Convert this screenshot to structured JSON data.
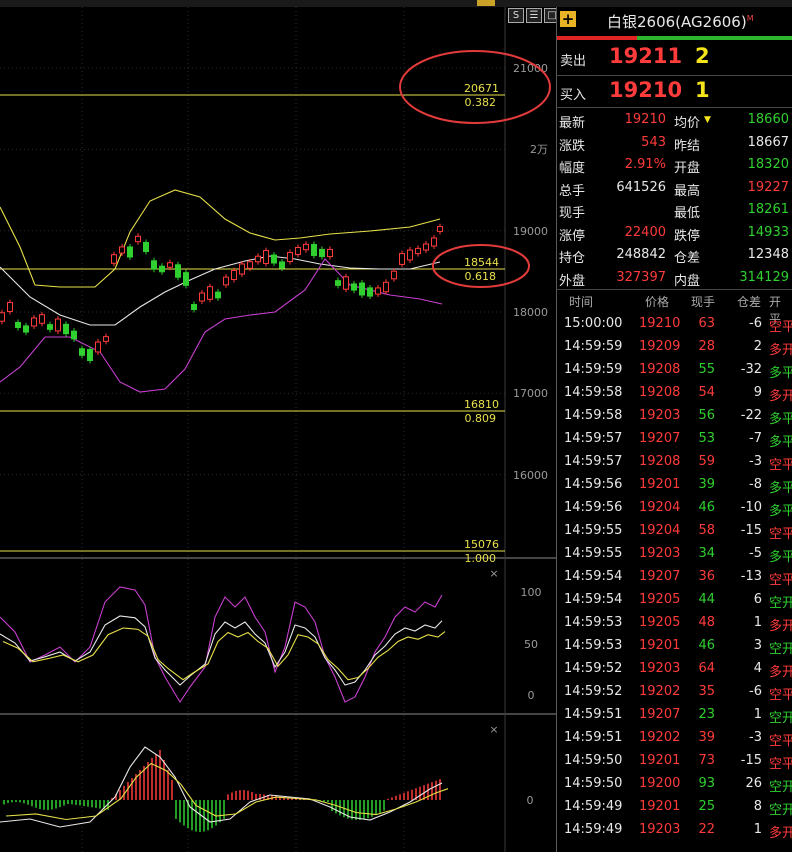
{
  "window_buttons": [
    "S",
    "☰",
    "□"
  ],
  "instrument": {
    "name": "白银2606(AG2606)",
    "marker": "M"
  },
  "quote": {
    "sell_label": "卖出",
    "sell_price": "19211",
    "sell_vol": "2",
    "buy_label": "买入",
    "buy_price": "19210",
    "buy_vol": "1"
  },
  "stats": [
    {
      "l1": "最新",
      "v1": "19210",
      "c1": "red",
      "l2": "均价",
      "v2": "18660",
      "c2": "green"
    },
    {
      "l1": "涨跌",
      "v1": "543",
      "c1": "red",
      "l2": "昨结",
      "v2": "18667",
      "c2": "white"
    },
    {
      "l1": "幅度",
      "v1": "2.91%",
      "c1": "red",
      "l2": "开盘",
      "v2": "18320",
      "c2": "green"
    },
    {
      "l1": "总手",
      "v1": "641526",
      "c1": "white",
      "l2": "最高",
      "v2": "19227",
      "c2": "red"
    },
    {
      "l1": "现手",
      "v1": "",
      "c1": "white",
      "l2": "最低",
      "v2": "18261",
      "c2": "green"
    },
    {
      "l1": "涨停",
      "v1": "22400",
      "c1": "red",
      "l2": "跌停",
      "v2": "14933",
      "c2": "green"
    },
    {
      "l1": "持仓",
      "v1": "248842",
      "c1": "white",
      "l2": "仓差",
      "v2": "12348",
      "c2": "white"
    },
    {
      "l1": "外盘",
      "v1": "327397",
      "c1": "red",
      "l2": "内盘",
      "v2": "314129",
      "c2": "green"
    }
  ],
  "trade_headers": [
    "时间",
    "价格",
    "现手",
    "仓差",
    "开平"
  ],
  "trades": [
    {
      "time": "15:00:00",
      "price": "19210",
      "vol": "63",
      "diff": "-6",
      "type": "空平",
      "pc": "red",
      "tc": "red"
    },
    {
      "time": "14:59:59",
      "price": "19209",
      "vol": "28",
      "diff": "2",
      "type": "多开",
      "pc": "red",
      "tc": "red"
    },
    {
      "time": "14:59:59",
      "price": "19208",
      "vol": "55",
      "diff": "-32",
      "type": "多平",
      "pc": "red",
      "tc": "green"
    },
    {
      "time": "14:59:58",
      "price": "19208",
      "vol": "54",
      "diff": "9",
      "type": "多开",
      "pc": "red",
      "tc": "red"
    },
    {
      "time": "14:59:58",
      "price": "19203",
      "vol": "56",
      "diff": "-22",
      "type": "多平",
      "pc": "red",
      "tc": "green"
    },
    {
      "time": "14:59:57",
      "price": "19207",
      "vol": "53",
      "diff": "-7",
      "type": "多平",
      "pc": "red",
      "tc": "green"
    },
    {
      "time": "14:59:57",
      "price": "19208",
      "vol": "59",
      "diff": "-3",
      "type": "空平",
      "pc": "red",
      "tc": "red"
    },
    {
      "time": "14:59:56",
      "price": "19201",
      "vol": "39",
      "diff": "-8",
      "type": "多平",
      "pc": "red",
      "tc": "green"
    },
    {
      "time": "14:59:56",
      "price": "19204",
      "vol": "46",
      "diff": "-10",
      "type": "多平",
      "pc": "red",
      "tc": "green"
    },
    {
      "time": "14:59:55",
      "price": "19204",
      "vol": "58",
      "diff": "-15",
      "type": "空平",
      "pc": "red",
      "tc": "red"
    },
    {
      "time": "14:59:55",
      "price": "19203",
      "vol": "34",
      "diff": "-5",
      "type": "多平",
      "pc": "red",
      "tc": "green"
    },
    {
      "time": "14:59:54",
      "price": "19207",
      "vol": "36",
      "diff": "-13",
      "type": "空平",
      "pc": "red",
      "tc": "red"
    },
    {
      "time": "14:59:54",
      "price": "19205",
      "vol": "44",
      "diff": "6",
      "type": "空开",
      "pc": "red",
      "tc": "green"
    },
    {
      "time": "14:59:53",
      "price": "19205",
      "vol": "48",
      "diff": "1",
      "type": "多开",
      "pc": "red",
      "tc": "red"
    },
    {
      "time": "14:59:53",
      "price": "19201",
      "vol": "46",
      "diff": "3",
      "type": "空开",
      "pc": "red",
      "tc": "green"
    },
    {
      "time": "14:59:52",
      "price": "19203",
      "vol": "64",
      "diff": "4",
      "type": "多开",
      "pc": "red",
      "tc": "red"
    },
    {
      "time": "14:59:52",
      "price": "19202",
      "vol": "35",
      "diff": "-6",
      "type": "空平",
      "pc": "red",
      "tc": "red"
    },
    {
      "time": "14:59:51",
      "price": "19207",
      "vol": "23",
      "diff": "1",
      "type": "空开",
      "pc": "red",
      "tc": "green"
    },
    {
      "time": "14:59:51",
      "price": "19202",
      "vol": "39",
      "diff": "-3",
      "type": "空平",
      "pc": "red",
      "tc": "red"
    },
    {
      "time": "14:59:50",
      "price": "19201",
      "vol": "73",
      "diff": "-15",
      "type": "空平",
      "pc": "red",
      "tc": "red"
    },
    {
      "time": "14:59:50",
      "price": "19200",
      "vol": "93",
      "diff": "26",
      "type": "空开",
      "pc": "red",
      "tc": "green"
    },
    {
      "time": "14:59:49",
      "price": "19201",
      "vol": "25",
      "diff": "8",
      "type": "空开",
      "pc": "red",
      "tc": "green"
    },
    {
      "time": "14:59:49",
      "price": "19203",
      "vol": "22",
      "diff": "1",
      "type": "多开",
      "pc": "red",
      "tc": "red"
    }
  ],
  "chart": {
    "price_axis": [
      "21000",
      "2万",
      "19000",
      "18000",
      "17000",
      "16000"
    ],
    "fib_levels": [
      {
        "price": "20671",
        "ratio": "0.382"
      },
      {
        "price": "18544",
        "ratio": "0.618"
      },
      {
        "price": "16810",
        "ratio": "0.809"
      },
      {
        "price": "15076",
        "ratio": "1.000"
      }
    ],
    "kdj_axis": [
      "100",
      "50",
      "0"
    ],
    "macd_axis": [
      "0"
    ],
    "close_glyph": "×"
  },
  "colors": {
    "up": "#ff3b3b",
    "down": "#2fd02f",
    "fib": "#e8e04a",
    "annotation": "#e33b3b"
  }
}
